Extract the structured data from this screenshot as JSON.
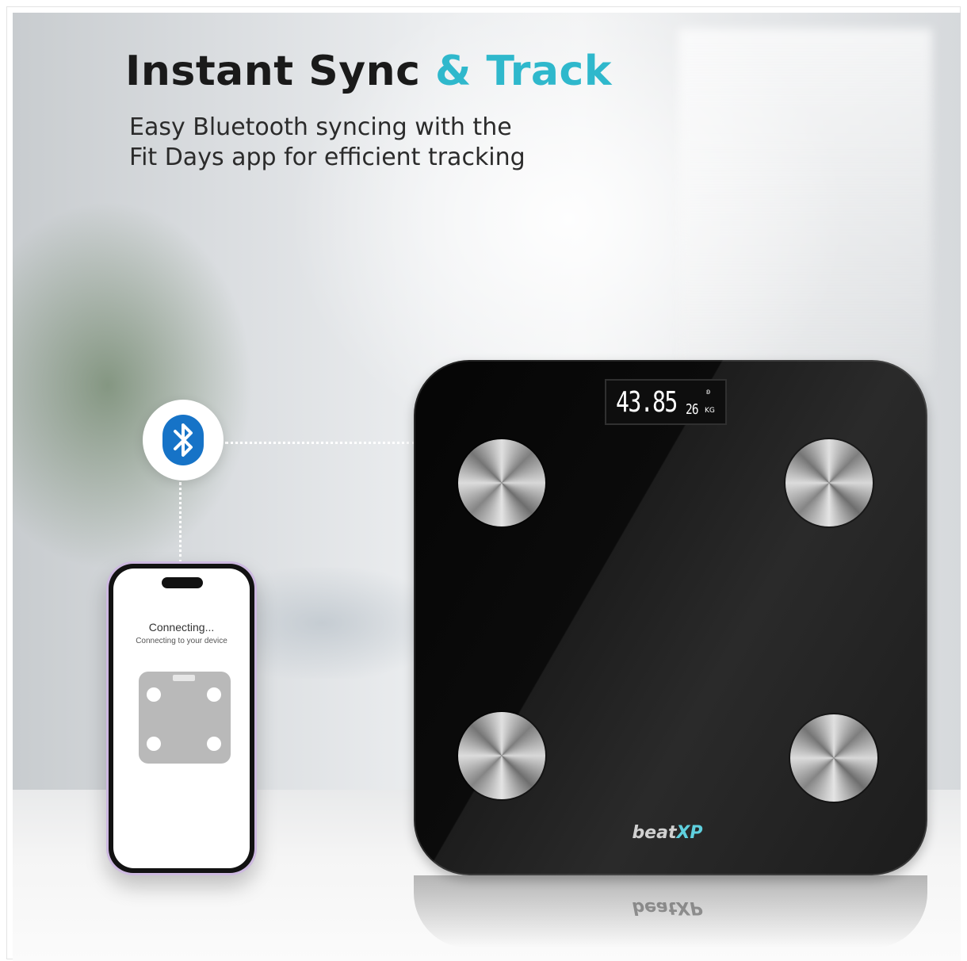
{
  "headline": {
    "main": "Instant Sync",
    "accent": "& Track",
    "subtitle_line1": "Easy Bluetooth syncing with the",
    "subtitle_line2": "Fit Days app for efficient tracking"
  },
  "colors": {
    "accent": "#2fb8cc",
    "bluetooth": "#1673c7",
    "phone_frame": "#cdb9e0"
  },
  "phone": {
    "status_title": "Connecting...",
    "status_subtitle": "Connecting to your device"
  },
  "scale": {
    "display_main": "43.85",
    "display_small": "26",
    "display_unit": "KG",
    "brand_main": "beat",
    "brand_accent": "XP"
  },
  "icons": {
    "bluetooth": "bluetooth-icon"
  }
}
